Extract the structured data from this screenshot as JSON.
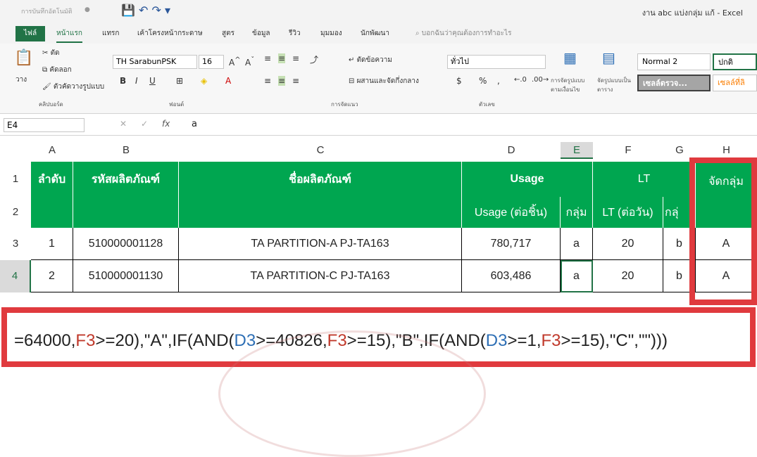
{
  "titlebar": {
    "autosave": "การบันทึกอัตโนมัติ",
    "autosave_state": "●",
    "qat": "💾 ↶ ↷ ▾",
    "title": "งาน abc แบ่งกลุ่ม แก้ - Excel"
  },
  "tabs": [
    "ไฟล์",
    "หน้าแรก",
    "แทรก",
    "เค้าโครงหน้ากระดาษ",
    "สูตร",
    "ข้อมูล",
    "รีวิว",
    "มุมมอง",
    "นักพัฒนา",
    "บอกฉันว่าคุณต้องการทำอะไร"
  ],
  "ribbon": {
    "paste": "วาง",
    "cut": "ตัด",
    "copy": "คัดลอก",
    "format_painter": "ตัวคัดวางรูปแบบ",
    "clipboard_group": "คลิปบอร์ด",
    "font_name": "TH SarabunPSK",
    "font_size": "16",
    "font_group": "ฟอนต์",
    "wrap_text": "ตัดข้อความ",
    "merge_center": "ผสานและจัดกึ่งกลาง",
    "alignment_group": "การจัดแนว",
    "number_format": "ทั่วไป",
    "number_group": "ตัวเลข",
    "currency": "$",
    "percent": "%",
    "comma": ",",
    "conditional_format": "การจัดรูปแบบตามเงื่อนไข",
    "format_table": "จัดรูปแบบเป็นตาราง",
    "style_normal2": "Normal 2",
    "style_normal": "ปกติ",
    "style_check": "เซลล์ตรวจ...",
    "style_linked": "เซลล์ที่ลิ"
  },
  "formula_bar": {
    "namebox": "E4",
    "fx": "fx",
    "value": "a"
  },
  "columns": [
    "A",
    "B",
    "C",
    "D",
    "E",
    "F",
    "G",
    "H"
  ],
  "rows": [
    "1",
    "2",
    "3",
    "4"
  ],
  "header": {
    "seq": "ลำดับ",
    "code": "รหัสผลิตภัณฑ์",
    "name": "ชื่อผลิตภัณฑ์",
    "usage": "Usage",
    "usage_per": "Usage (ต่อชิ้น)",
    "group": "กลุ่ม",
    "lt": "LT",
    "lt_per": "LT (ต่อวัน)",
    "group2": "กลุ่",
    "grouping": "จัดกลุ่ม"
  },
  "table_rows": [
    {
      "seq": "1",
      "code": "510000001128",
      "name": "TA PARTITION-A PJ-TA163",
      "usage": "780,717",
      "grp": "a",
      "lt": "20",
      "grp2": "b",
      "result": "A"
    },
    {
      "seq": "2",
      "code": "510000001130",
      "name": "TA PARTITION-C PJ-TA163",
      "usage": "603,486",
      "grp": "a",
      "lt": "20",
      "grp2": "b",
      "result": "A"
    }
  ],
  "formula_callout": [
    {
      "t": "=64000,",
      "c": "c-black"
    },
    {
      "t": "F3",
      "c": "c-red"
    },
    {
      "t": ">=20),\"A\",IF(AND(",
      "c": "c-black"
    },
    {
      "t": "D3",
      "c": "c-blue"
    },
    {
      "t": ">=40826,",
      "c": "c-black"
    },
    {
      "t": "F3",
      "c": "c-red"
    },
    {
      "t": ">=15),\"B\",IF(AND(",
      "c": "c-black"
    },
    {
      "t": "D3",
      "c": "c-blue"
    },
    {
      "t": ">=1,",
      "c": "c-black"
    },
    {
      "t": "F3",
      "c": "c-red"
    },
    {
      "t": ">=15),\"C\",\"\")))",
      "c": "c-black"
    }
  ],
  "colors": {
    "header_green": "#00a650",
    "excel_green": "#217346",
    "callout_red": "#e03a3e"
  }
}
